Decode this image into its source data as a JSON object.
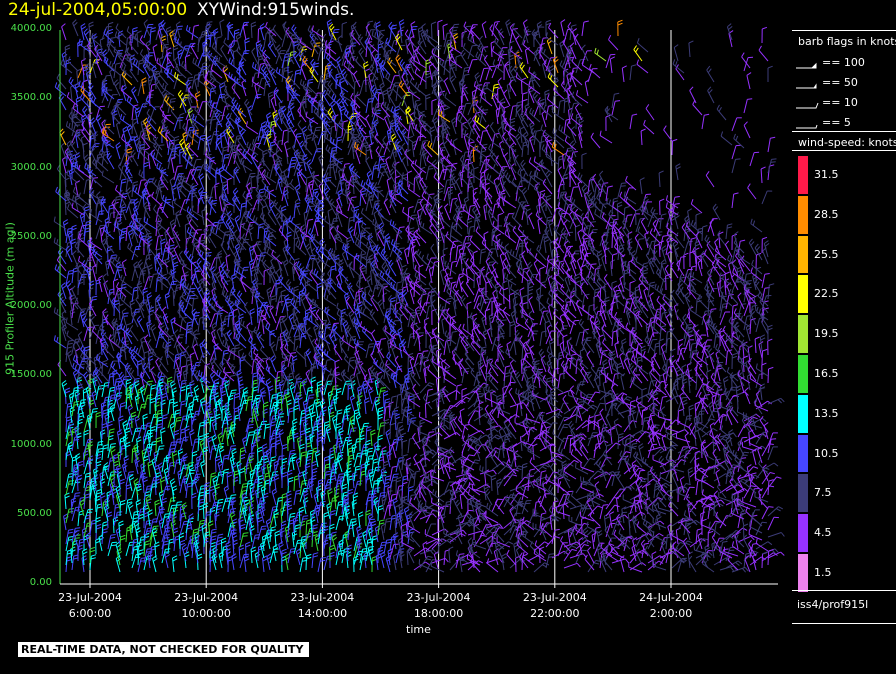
{
  "header": {
    "date_time": "24-jul-2004,05:00:00",
    "product": "XYWind:915winds."
  },
  "chart_data": {
    "type": "wind-barb",
    "ylabel": "915 Profiler Altitude (m agl)",
    "xlabel": "time",
    "ylim": [
      0,
      4000
    ],
    "yticks": [
      "0.00",
      "500.00",
      "1000.00",
      "1500.00",
      "2000.00",
      "2500.00",
      "3000.00",
      "3500.00",
      "4000.00"
    ],
    "xticks": [
      {
        "date": "23-Jul-2004",
        "time": "6:00:00"
      },
      {
        "date": "23-Jul-2004",
        "time": "10:00:00"
      },
      {
        "date": "23-Jul-2004",
        "time": "14:00:00"
      },
      {
        "date": "23-Jul-2004",
        "time": "18:00:00"
      },
      {
        "date": "23-Jul-2004",
        "time": "22:00:00"
      },
      {
        "date": "24-Jul-2004",
        "time": "2:00:00"
      }
    ],
    "time_range_hours": [
      "23-Jul-2004 5:00",
      "24-Jul-2004 5:00"
    ],
    "grid": "vertical-lines-at-x-ticks",
    "legend_position": "right"
  },
  "legend": {
    "flags_title": "barb flags in knots",
    "flags": [
      {
        "label": "== 100",
        "kind": "pennant"
      },
      {
        "label": "== 50",
        "kind": "pennant-small"
      },
      {
        "label": "== 10",
        "kind": "full"
      },
      {
        "label": "== 5",
        "kind": "half"
      }
    ],
    "colorbar_title": "wind-speed: knots",
    "colorbar": [
      {
        "label": "31.5",
        "color": "#ff1a4a"
      },
      {
        "label": "28.5",
        "color": "#ff8c00"
      },
      {
        "label": "25.5",
        "color": "#ffb400"
      },
      {
        "label": "22.5",
        "color": "#ffff00"
      },
      {
        "label": "19.5",
        "color": "#a0e632"
      },
      {
        "label": "16.5",
        "color": "#32dc32"
      },
      {
        "label": "13.5",
        "color": "#00ffff"
      },
      {
        "label": "10.5",
        "color": "#4646ff"
      },
      {
        "label": "7.5",
        "color": "#3c3c78"
      },
      {
        "label": "4.5",
        "color": "#9632ff"
      },
      {
        "label": "1.5",
        "color": "#ee82ee"
      }
    ],
    "source": "iss4/prof915l"
  },
  "footer": {
    "disclaimer": "REAL-TIME DATA, NOT CHECKED FOR QUALITY"
  },
  "colors": {
    "axis_y": "#4ae04a",
    "title_date": "#ffff00"
  }
}
